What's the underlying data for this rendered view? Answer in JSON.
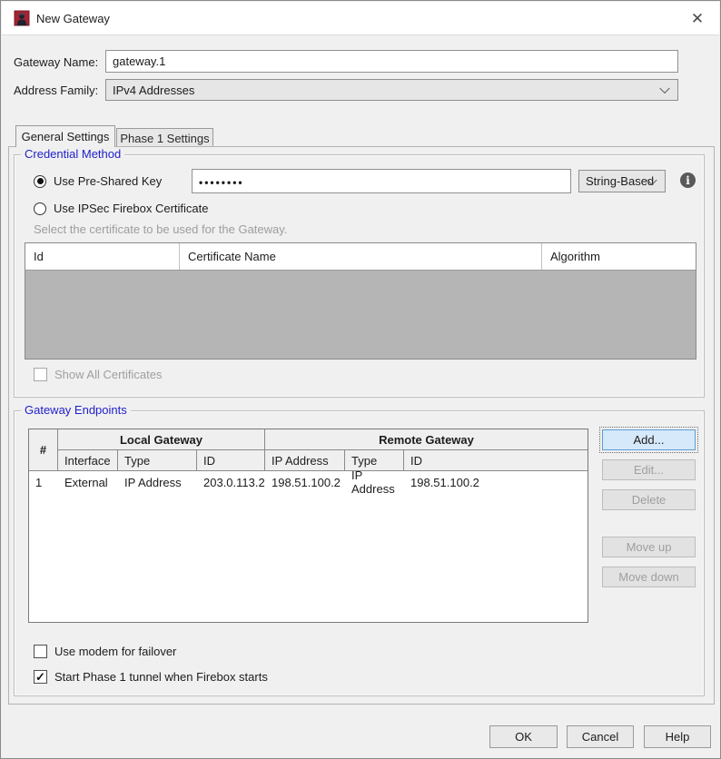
{
  "window": {
    "title": "New Gateway"
  },
  "icons": {
    "close": "✕",
    "info": "i",
    "checkmark": "✓"
  },
  "form": {
    "gateway_name_label": "Gateway Name:",
    "gateway_name_value": "gateway.1",
    "address_family_label": "Address Family:",
    "address_family_value": "IPv4 Addresses"
  },
  "tabs": [
    {
      "label": "General Settings"
    },
    {
      "label": "Phase 1 Settings"
    }
  ],
  "credential_method": {
    "legend": "Credential Method",
    "radio_psk_label": "Use Pre-Shared Key",
    "psk_value": "••••••••",
    "psk_type_value": "String-Based",
    "radio_cert_label": "Use IPSec Firebox Certificate",
    "cert_hint": "Select the certificate to be used for the Gateway.",
    "cert_headers": [
      "Id",
      "Certificate Name",
      "Algorithm"
    ],
    "show_all_label": "Show All Certificates"
  },
  "gateway_endpoints": {
    "legend": "Gateway Endpoints",
    "table": {
      "hash_header": "#",
      "group_headers": [
        "Local Gateway",
        "Remote Gateway"
      ],
      "sub_headers": [
        "Interface",
        "Type",
        "ID",
        "IP Address",
        "Type",
        "ID"
      ],
      "rows": [
        [
          "1",
          "External",
          "IP Address",
          "203.0.113.2",
          "198.51.100.2",
          "IP Address",
          "198.51.100.2"
        ]
      ]
    },
    "buttons": {
      "add": "Add...",
      "edit": "Edit...",
      "delete": "Delete",
      "move_up": "Move up",
      "move_down": "Move down"
    },
    "modem_checkbox_label": "Use modem for failover",
    "phase1_checkbox_label": "Start Phase 1 tunnel when Firebox starts"
  },
  "footer": {
    "ok": "OK",
    "cancel": "Cancel",
    "help": "Help"
  }
}
